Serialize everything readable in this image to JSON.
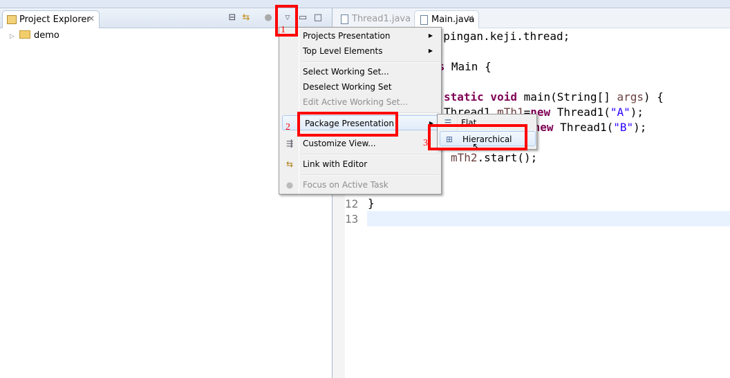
{
  "project_explorer": {
    "tab_label": "Project Explorer",
    "tree": [
      {
        "label": "demo",
        "icon": "project-folder-icon"
      }
    ]
  },
  "editor": {
    "tabs": [
      {
        "label": "Thread1.java",
        "active": false
      },
      {
        "label": "Main.java",
        "active": true
      }
    ],
    "code_fragments": {
      "package": "n.pingan.keji.thread;",
      "class_kw": "ss",
      "class_name": " Main {",
      "static_kw": "static void",
      "main_sig": " main(String[] ",
      "args": "args",
      "main_end": ") {",
      "line_t1_a": "Thread1 ",
      "line_t1_var": "mTh1",
      "line_t1_b": "=",
      "new_kw": "new",
      "line_t1_c": " Thread1(",
      "str_a": "\"A\"",
      "line_end": ");",
      "line_t2_a": "=",
      "str_b": "\"B\"",
      "start2_var": "mTh2",
      "start2": ".start();",
      "close_brace": "}",
      "line_12": "12",
      "line_13": "13"
    }
  },
  "view_menu": {
    "items": [
      {
        "label": "Projects Presentation",
        "submenu": true
      },
      {
        "label": "Top Level Elements",
        "submenu": true
      },
      {
        "label": "Select Working Set..."
      },
      {
        "label": "Deselect Working Set"
      },
      {
        "label": "Edit Active Working Set...",
        "disabled": true
      },
      {
        "label": "Package Presentation",
        "submenu": true,
        "highlighted": true
      },
      {
        "label": "Customize View...",
        "icon": "customize-view-icon"
      },
      {
        "label": "Link with Editor",
        "icon": "link-with-editor-icon"
      },
      {
        "label": "Focus on Active Task",
        "icon": "focus-task-icon",
        "disabled": true
      }
    ],
    "package_presentation_submenu": [
      {
        "label": "Flat",
        "icon": "flat-list-icon"
      },
      {
        "label": "Hierarchical",
        "icon": "hierarchical-tree-icon",
        "highlighted": true
      }
    ]
  },
  "annotations": {
    "step1": "1",
    "step2": "2",
    "step3": "3",
    "color": "#ff0000"
  }
}
